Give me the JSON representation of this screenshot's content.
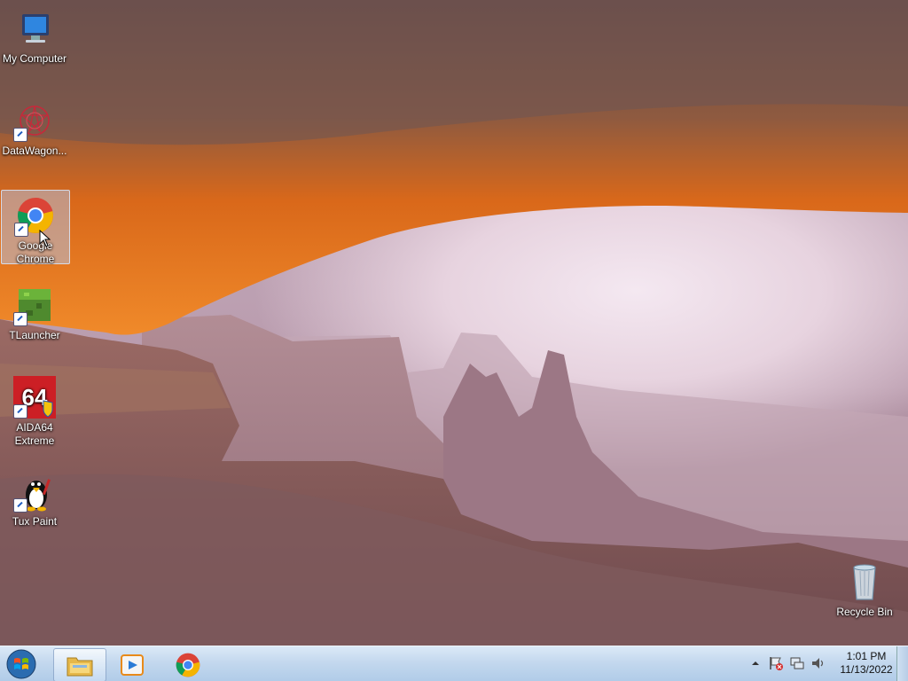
{
  "desktop": {
    "wallpaper": "red-rock-canyon-arch",
    "icons": [
      {
        "label": "My Computer",
        "icon": "computer-icon"
      },
      {
        "label": "DataWagon...",
        "icon": "datawagon-icon"
      },
      {
        "label": "Google Chrome",
        "label_line1": "Google",
        "label_line2": "Chrome",
        "icon": "chrome-icon",
        "selected": true
      },
      {
        "label": "TLauncher",
        "icon": "tlauncher-icon"
      },
      {
        "label": "AIDA64 Extreme",
        "label_line1": "AIDA64",
        "label_line2": "Extreme",
        "icon": "aida64-icon"
      },
      {
        "label": "Tux Paint",
        "icon": "tux-paint-icon"
      },
      {
        "label": "Recycle Bin",
        "icon": "recycle-bin-icon"
      }
    ]
  },
  "taskbar": {
    "start_icon": "windows-start-icon",
    "pinned": [
      {
        "name": "explorer",
        "icon": "folder-icon",
        "active": true
      },
      {
        "name": "media-player",
        "icon": "media-player-icon"
      },
      {
        "name": "chrome",
        "icon": "chrome-icon"
      }
    ],
    "tray": {
      "icons": [
        "show-hidden-icons-arrow",
        "action-center-flag-icon",
        "network-icon",
        "volume-icon"
      ],
      "time": "1:01 PM",
      "date": "11/13/2022"
    }
  },
  "colors": {
    "taskbar_top": "#dbe9f7",
    "taskbar_bottom": "#b0cbe8",
    "selection": "#adcfff"
  }
}
